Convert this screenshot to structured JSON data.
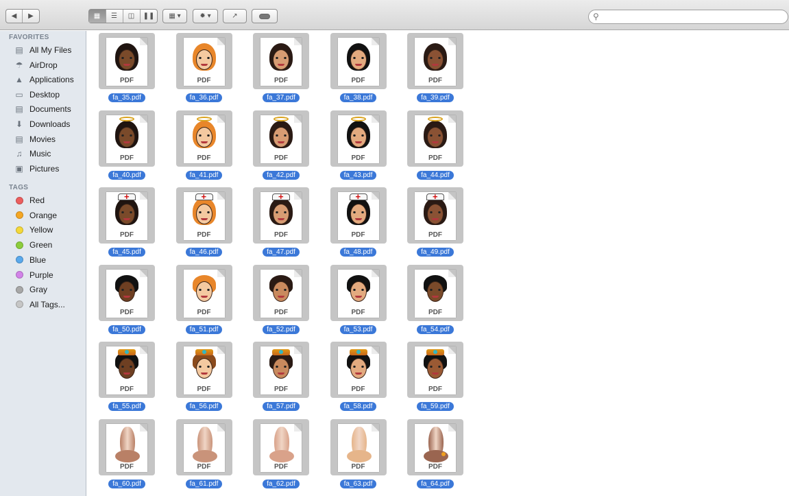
{
  "toolbar": {
    "back_icon": "back-arrow-icon",
    "forward_icon": "forward-arrow-icon",
    "view_modes": [
      "icon-view",
      "list-view",
      "column-view",
      "cover-flow-view"
    ],
    "selected_view": "icon-view",
    "arrange_icon": "arrange-icon",
    "action_icon": "gear-icon",
    "share_icon": "share-icon",
    "tags_icon": "tag-icon",
    "search": {
      "placeholder": "",
      "value": ""
    }
  },
  "sidebar": {
    "favorites_heading": "FAVORITES",
    "favorites": [
      {
        "label": "All My Files",
        "icon": "all-files-icon"
      },
      {
        "label": "AirDrop",
        "icon": "airdrop-icon"
      },
      {
        "label": "Applications",
        "icon": "applications-icon"
      },
      {
        "label": "Desktop",
        "icon": "desktop-icon"
      },
      {
        "label": "Documents",
        "icon": "documents-icon"
      },
      {
        "label": "Downloads",
        "icon": "downloads-icon"
      },
      {
        "label": "Movies",
        "icon": "movies-icon"
      },
      {
        "label": "Music",
        "icon": "music-icon"
      },
      {
        "label": "Pictures",
        "icon": "pictures-icon"
      }
    ],
    "tags_heading": "TAGS",
    "tags": [
      {
        "label": "Red",
        "color": "#ec5e5e"
      },
      {
        "label": "Orange",
        "color": "#f5a623"
      },
      {
        "label": "Yellow",
        "color": "#f4d83a"
      },
      {
        "label": "Green",
        "color": "#8ccd3c"
      },
      {
        "label": "Blue",
        "color": "#5aa9ec"
      },
      {
        "label": "Purple",
        "color": "#d283e8"
      },
      {
        "label": "Gray",
        "color": "#a8a8a8"
      },
      {
        "label": "All Tags...",
        "color": "#c6c6c6"
      }
    ]
  },
  "files": [
    {
      "name": "fa_35.pdf",
      "kind": "woman",
      "skin": "#7a4a2a",
      "hair": "#1f1410",
      "accessory": "veil"
    },
    {
      "name": "fa_36.pdf",
      "kind": "woman",
      "skin": "#f4c9a0",
      "hair": "#e8862a",
      "accessory": "veil"
    },
    {
      "name": "fa_37.pdf",
      "kind": "woman",
      "skin": "#d79c73",
      "hair": "#2a1a14",
      "accessory": "veil"
    },
    {
      "name": "fa_38.pdf",
      "kind": "woman",
      "skin": "#e3aa7f",
      "hair": "#111111",
      "accessory": "veil"
    },
    {
      "name": "fa_39.pdf",
      "kind": "woman",
      "skin": "#8a5234",
      "hair": "#2a1a14",
      "accessory": "veil"
    },
    {
      "name": "fa_40.pdf",
      "kind": "woman",
      "skin": "#7a4a2a",
      "hair": "#1f1410",
      "accessory": "halo"
    },
    {
      "name": "fa_41.pdf",
      "kind": "woman",
      "skin": "#f4c9a0",
      "hair": "#e8862a",
      "accessory": "halo"
    },
    {
      "name": "fa_42.pdf",
      "kind": "woman",
      "skin": "#d79c73",
      "hair": "#2a1a14",
      "accessory": "halo"
    },
    {
      "name": "fa_43.pdf",
      "kind": "woman",
      "skin": "#e3aa7f",
      "hair": "#111111",
      "accessory": "halo"
    },
    {
      "name": "fa_44.pdf",
      "kind": "woman",
      "skin": "#8a5234",
      "hair": "#2a1a14",
      "accessory": "halo"
    },
    {
      "name": "fa_45.pdf",
      "kind": "woman",
      "skin": "#7a4a2a",
      "hair": "#1f1410",
      "accessory": "nurse"
    },
    {
      "name": "fa_46.pdf",
      "kind": "woman",
      "skin": "#f4c9a0",
      "hair": "#e8862a",
      "accessory": "nurse"
    },
    {
      "name": "fa_47.pdf",
      "kind": "woman",
      "skin": "#d79c73",
      "hair": "#2a1a14",
      "accessory": "nurse"
    },
    {
      "name": "fa_48.pdf",
      "kind": "woman",
      "skin": "#e3aa7f",
      "hair": "#111111",
      "accessory": "nurse"
    },
    {
      "name": "fa_49.pdf",
      "kind": "woman",
      "skin": "#8a5234",
      "hair": "#2a1a14",
      "accessory": "nurse"
    },
    {
      "name": "fa_50.pdf",
      "kind": "man",
      "skin": "#6e3f22",
      "hair": "#111111",
      "accessory": "none"
    },
    {
      "name": "fa_51.pdf",
      "kind": "man",
      "skin": "#f4c9a0",
      "hair": "#e8862a",
      "accessory": "none"
    },
    {
      "name": "fa_52.pdf",
      "kind": "man",
      "skin": "#c98a5e",
      "hair": "#2a1a14",
      "accessory": "none"
    },
    {
      "name": "fa_53.pdf",
      "kind": "man",
      "skin": "#e3aa7f",
      "hair": "#111111",
      "accessory": "none"
    },
    {
      "name": "fa_54.pdf",
      "kind": "man",
      "skin": "#7a4a2a",
      "hair": "#111111",
      "accessory": "none"
    },
    {
      "name": "fa_55.pdf",
      "kind": "man",
      "skin": "#6e3f22",
      "hair": "#111111",
      "accessory": "crown"
    },
    {
      "name": "fa_56.pdf",
      "kind": "man",
      "skin": "#f4c9a0",
      "hair": "#8a4a1c",
      "accessory": "crown"
    },
    {
      "name": "fa_57.pdf",
      "kind": "man",
      "skin": "#c98a5e",
      "hair": "#2a1a14",
      "accessory": "crown"
    },
    {
      "name": "fa_58.pdf",
      "kind": "man",
      "skin": "#e3aa7f",
      "hair": "#111111",
      "accessory": "crown"
    },
    {
      "name": "fa_59.pdf",
      "kind": "man",
      "skin": "#9a5a34",
      "hair": "#111111",
      "accessory": "crown"
    },
    {
      "name": "fa_60.pdf",
      "kind": "nose",
      "skin": "#b98066",
      "hair": "",
      "accessory": "none"
    },
    {
      "name": "fa_61.pdf",
      "kind": "nose",
      "skin": "#c9937a",
      "hair": "",
      "accessory": "none"
    },
    {
      "name": "fa_62.pdf",
      "kind": "nose",
      "skin": "#d9a28a",
      "hair": "",
      "accessory": "none"
    },
    {
      "name": "fa_63.pdf",
      "kind": "nose",
      "skin": "#e6b58a",
      "hair": "",
      "accessory": "none"
    },
    {
      "name": "fa_64.pdf",
      "kind": "nose",
      "skin": "#9a6550",
      "hair": "",
      "accessory": "piercing"
    }
  ],
  "page_label": "PDF"
}
